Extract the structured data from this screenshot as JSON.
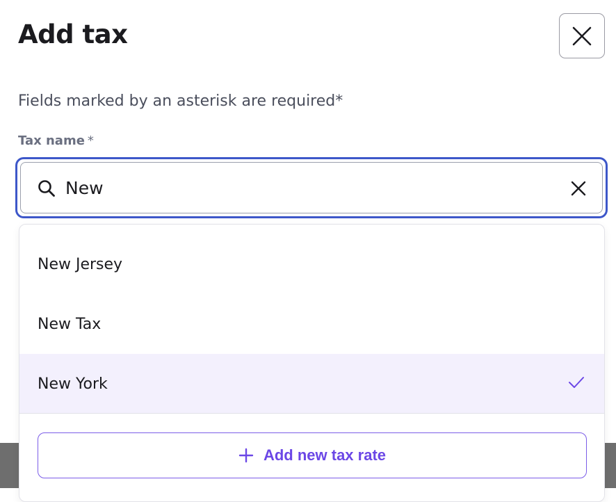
{
  "modal": {
    "title": "Add tax",
    "subtitle": "Fields marked by an asterisk are required*"
  },
  "field": {
    "label": "Tax name",
    "required_mark": "*",
    "value": "New"
  },
  "dropdown": {
    "options": [
      {
        "label": "New Jersey",
        "selected": false
      },
      {
        "label": "New Tax",
        "selected": false
      },
      {
        "label": "New York",
        "selected": true
      }
    ],
    "add_button_label": "Add new tax rate"
  },
  "icons": {
    "close": "close-icon",
    "search": "search-icon",
    "clear": "clear-icon",
    "check": "check-icon",
    "plus": "plus-icon"
  },
  "colors": {
    "focus_border": "#3d57c9",
    "accent": "#6b47e6",
    "selected_bg": "#f3f0fd"
  }
}
